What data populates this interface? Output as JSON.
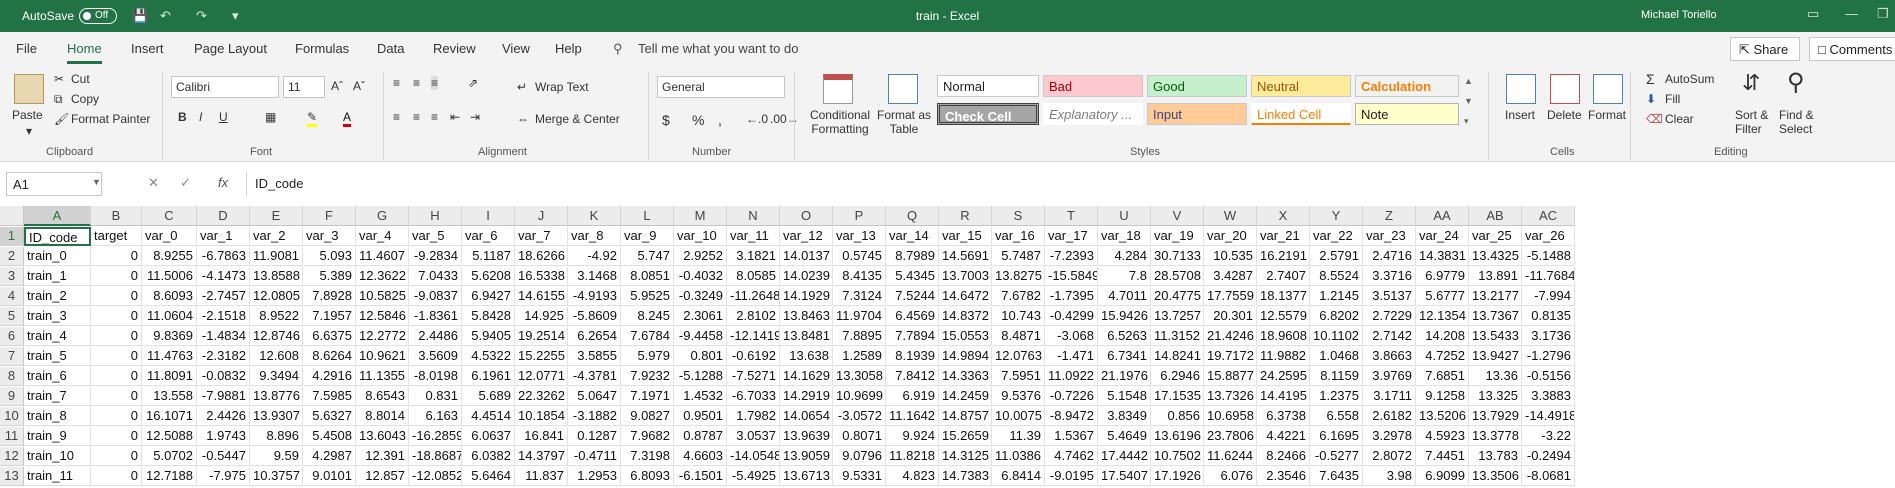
{
  "titlebar": {
    "autosave_label": "AutoSave",
    "autosave_state": "Off",
    "title": "train  -  Excel",
    "user": "Michael Toriello"
  },
  "menu": {
    "tabs": [
      "File",
      "Home",
      "Insert",
      "Page Layout",
      "Formulas",
      "Data",
      "Review",
      "View",
      "Help"
    ],
    "active_tab": "Home",
    "tell_me": "Tell me what you want to do",
    "share": "Share",
    "comments": "Comments"
  },
  "ribbon": {
    "clipboard": {
      "label": "Clipboard",
      "paste": "Paste",
      "cut": "Cut",
      "copy": "Copy",
      "format_painter": "Format Painter"
    },
    "font": {
      "label": "Font",
      "name": "Calibri",
      "size": "11"
    },
    "alignment": {
      "label": "Alignment",
      "wrap_text": "Wrap Text",
      "merge_center": "Merge & Center"
    },
    "number": {
      "label": "Number",
      "format": "General"
    },
    "styles": {
      "label": "Styles",
      "conditional_formatting": "Conditional Formatting",
      "format_as_table": "Format as Table",
      "cells": [
        "Normal",
        "Bad",
        "Good",
        "Neutral",
        "Calculation",
        "Check Cell",
        "Explanatory ...",
        "Input",
        "Linked Cell",
        "Note"
      ]
    },
    "cells": {
      "label": "Cells",
      "insert": "Insert",
      "delete": "Delete",
      "format": "Format"
    },
    "editing": {
      "label": "Editing",
      "autosum": "AutoSum",
      "fill": "Fill",
      "clear": "Clear",
      "sort_filter": "Sort & Filter",
      "find_select": "Find & Select"
    }
  },
  "formula_bar": {
    "name_box": "A1",
    "formula": "ID_code"
  },
  "sheet": {
    "columns": [
      "A",
      "B",
      "C",
      "D",
      "E",
      "F",
      "G",
      "H",
      "I",
      "J",
      "K",
      "L",
      "M",
      "N",
      "O",
      "P",
      "Q",
      "R",
      "S",
      "T",
      "U",
      "V",
      "W",
      "X",
      "Y",
      "Z",
      "AA",
      "AB",
      "AC"
    ],
    "header_row": [
      "ID_code",
      "target",
      "var_0",
      "var_1",
      "var_2",
      "var_3",
      "var_4",
      "var_5",
      "var_6",
      "var_7",
      "var_8",
      "var_9",
      "var_10",
      "var_11",
      "var_12",
      "var_13",
      "var_14",
      "var_15",
      "var_16",
      "var_17",
      "var_18",
      "var_19",
      "var_20",
      "var_21",
      "var_22",
      "var_23",
      "var_24",
      "var_25",
      "var_26"
    ],
    "rows": [
      [
        "train_0",
        "0",
        "8.9255",
        "-6.7863",
        "11.9081",
        "5.093",
        "11.4607",
        "-9.2834",
        "5.1187",
        "18.6266",
        "-4.92",
        "5.747",
        "2.9252",
        "3.1821",
        "14.0137",
        "0.5745",
        "8.7989",
        "14.5691",
        "5.7487",
        "-7.2393",
        "4.284",
        "30.7133",
        "10.535",
        "16.2191",
        "2.5791",
        "2.4716",
        "14.3831",
        "13.4325",
        "-5.1488"
      ],
      [
        "train_1",
        "0",
        "11.5006",
        "-4.1473",
        "13.8588",
        "5.389",
        "12.3622",
        "7.0433",
        "5.6208",
        "16.5338",
        "3.1468",
        "8.0851",
        "-0.4032",
        "8.0585",
        "14.0239",
        "8.4135",
        "5.4345",
        "13.7003",
        "13.8275",
        "-15.5849",
        "7.8",
        "28.5708",
        "3.4287",
        "2.7407",
        "8.5524",
        "3.3716",
        "6.9779",
        "13.891",
        "-11.7684"
      ],
      [
        "train_2",
        "0",
        "8.6093",
        "-2.7457",
        "12.0805",
        "7.8928",
        "10.5825",
        "-9.0837",
        "6.9427",
        "14.6155",
        "-4.9193",
        "5.9525",
        "-0.3249",
        "-11.2648",
        "14.1929",
        "7.3124",
        "7.5244",
        "14.6472",
        "7.6782",
        "-1.7395",
        "4.7011",
        "20.4775",
        "17.7559",
        "18.1377",
        "1.2145",
        "3.5137",
        "5.6777",
        "13.2177",
        "-7.994"
      ],
      [
        "train_3",
        "0",
        "11.0604",
        "-2.1518",
        "8.9522",
        "7.1957",
        "12.5846",
        "-1.8361",
        "5.8428",
        "14.925",
        "-5.8609",
        "8.245",
        "2.3061",
        "2.8102",
        "13.8463",
        "11.9704",
        "6.4569",
        "14.8372",
        "10.743",
        "-0.4299",
        "15.9426",
        "13.7257",
        "20.301",
        "12.5579",
        "6.8202",
        "2.7229",
        "12.1354",
        "13.7367",
        "0.8135"
      ],
      [
        "train_4",
        "0",
        "9.8369",
        "-1.4834",
        "12.8746",
        "6.6375",
        "12.2772",
        "2.4486",
        "5.9405",
        "19.2514",
        "6.2654",
        "7.6784",
        "-9.4458",
        "-12.1419",
        "13.8481",
        "7.8895",
        "7.7894",
        "15.0553",
        "8.4871",
        "-3.068",
        "6.5263",
        "11.3152",
        "21.4246",
        "18.9608",
        "10.1102",
        "2.7142",
        "14.208",
        "13.5433",
        "3.1736"
      ],
      [
        "train_5",
        "0",
        "11.4763",
        "-2.3182",
        "12.608",
        "8.6264",
        "10.9621",
        "3.5609",
        "4.5322",
        "15.2255",
        "3.5855",
        "5.979",
        "0.801",
        "-0.6192",
        "13.638",
        "1.2589",
        "8.1939",
        "14.9894",
        "12.0763",
        "-1.471",
        "6.7341",
        "14.8241",
        "19.7172",
        "11.9882",
        "1.0468",
        "3.8663",
        "4.7252",
        "13.9427",
        "-1.2796"
      ],
      [
        "train_6",
        "0",
        "11.8091",
        "-0.0832",
        "9.3494",
        "4.2916",
        "11.1355",
        "-8.0198",
        "6.1961",
        "12.0771",
        "-4.3781",
        "7.9232",
        "-5.1288",
        "-7.5271",
        "14.1629",
        "13.3058",
        "7.8412",
        "14.3363",
        "7.5951",
        "11.0922",
        "21.1976",
        "6.2946",
        "15.8877",
        "24.2595",
        "8.1159",
        "3.9769",
        "7.6851",
        "13.36",
        "-0.5156"
      ],
      [
        "train_7",
        "0",
        "13.558",
        "-7.9881",
        "13.8776",
        "7.5985",
        "8.6543",
        "0.831",
        "5.689",
        "22.3262",
        "5.0647",
        "7.1971",
        "1.4532",
        "-6.7033",
        "14.2919",
        "10.9699",
        "6.919",
        "14.2459",
        "9.5376",
        "-0.7226",
        "5.1548",
        "17.1535",
        "13.7326",
        "14.4195",
        "1.2375",
        "3.1711",
        "9.1258",
        "13.325",
        "3.3883"
      ],
      [
        "train_8",
        "0",
        "16.1071",
        "2.4426",
        "13.9307",
        "5.6327",
        "8.8014",
        "6.163",
        "4.4514",
        "10.1854",
        "-3.1882",
        "9.0827",
        "0.9501",
        "1.7982",
        "14.0654",
        "-3.0572",
        "11.1642",
        "14.8757",
        "10.0075",
        "-8.9472",
        "3.8349",
        "0.856",
        "10.6958",
        "6.3738",
        "6.558",
        "2.6182",
        "13.5206",
        "13.7929",
        "-14.4918"
      ],
      [
        "train_9",
        "0",
        "12.5088",
        "1.9743",
        "8.896",
        "5.4508",
        "13.6043",
        "-16.2859",
        "6.0637",
        "16.841",
        "0.1287",
        "7.9682",
        "0.8787",
        "3.0537",
        "13.9639",
        "0.8071",
        "9.924",
        "15.2659",
        "11.39",
        "1.5367",
        "5.4649",
        "13.6196",
        "23.7806",
        "4.4221",
        "6.1695",
        "3.2978",
        "4.5923",
        "13.3778",
        "-3.22"
      ],
      [
        "train_10",
        "0",
        "5.0702",
        "-0.5447",
        "9.59",
        "4.2987",
        "12.391",
        "-18.8687",
        "6.0382",
        "14.3797",
        "-0.4711",
        "7.3198",
        "4.6603",
        "-14.0548",
        "13.9059",
        "9.0796",
        "11.8218",
        "14.3125",
        "11.0386",
        "4.7462",
        "17.4442",
        "10.7502",
        "11.6244",
        "8.2466",
        "-0.5277",
        "2.8072",
        "7.4451",
        "13.783",
        "-0.2494"
      ],
      [
        "train_11",
        "0",
        "12.7188",
        "-7.975",
        "10.3757",
        "9.0101",
        "12.857",
        "-12.0852",
        "5.6464",
        "11.837",
        "1.2953",
        "6.8093",
        "-6.1501",
        "-5.4925",
        "13.6713",
        "9.5331",
        "4.823",
        "14.7383",
        "6.8414",
        "-9.0195",
        "17.5407",
        "17.1926",
        "6.076",
        "2.3546",
        "7.6435",
        "3.98",
        "6.9099",
        "13.3506",
        "-8.0681"
      ]
    ]
  },
  "colors": {
    "brand": "#217346",
    "bad_bg": "#ffc7ce",
    "good_bg": "#c6efce",
    "neutral_bg": "#ffeb9c",
    "input_bg": "#ffcc99",
    "note_bg": "#ffffcc",
    "check_bg": "#a5a5a5"
  }
}
